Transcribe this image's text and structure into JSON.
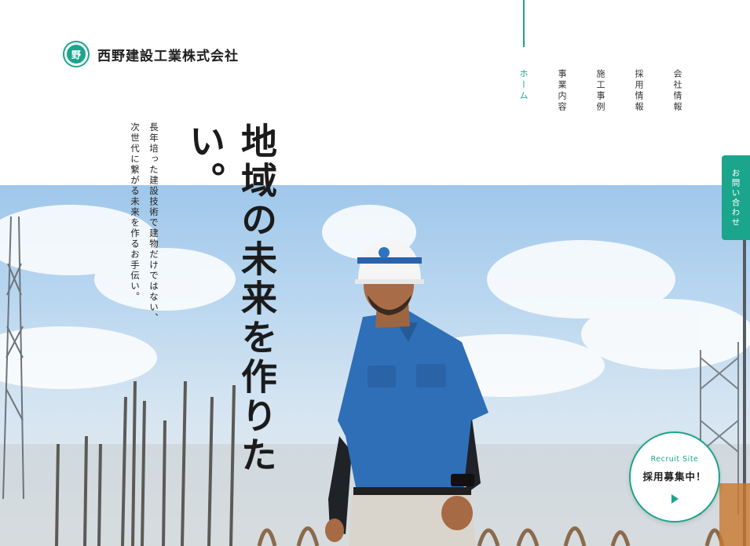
{
  "brand": {
    "name": "西野建設工業株式会社",
    "mark_char": "野",
    "accent": "#1aa58c"
  },
  "nav": {
    "items": [
      {
        "label": "ホーム",
        "active": true
      },
      {
        "label": "事業内容"
      },
      {
        "label": "施工事例"
      },
      {
        "label": "採用情報"
      },
      {
        "label": "会社情報"
      }
    ]
  },
  "hero": {
    "headline": "地域の未来を作りたい。",
    "subcopy_line1": "長年培った建設技術で建物だけではない、",
    "subcopy_line2": "次世代に繋がる未来を作るお手伝い。"
  },
  "contact_tab": {
    "label": "お問い合わせ"
  },
  "recruit": {
    "label_en": "Recruit Site",
    "label_jp": "採用募集中！"
  }
}
